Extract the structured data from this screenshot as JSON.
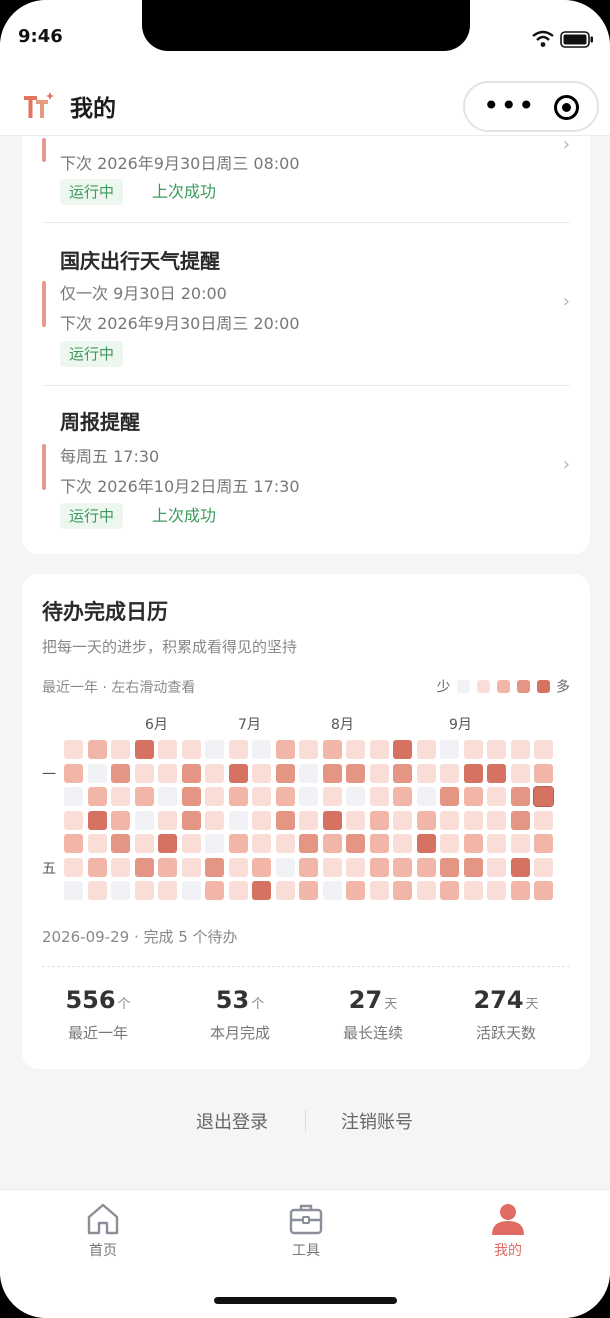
{
  "status": {
    "time": "9:46"
  },
  "header": {
    "title": "我的"
  },
  "reminders": [
    {
      "title": "",
      "line1": "",
      "next": "下次 2026年9月30日周三 08:00",
      "status": "运行中",
      "last": "上次成功"
    },
    {
      "title": "国庆出行天气提醒",
      "line1": "仅一次 9月30日 20:00",
      "next": "下次 2026年9月30日周三 20:00",
      "status": "运行中",
      "last": ""
    },
    {
      "title": "周报提醒",
      "line1": "每周五 17:30",
      "next": "下次 2026年10月2日周五 17:30",
      "status": "运行中",
      "last": "上次成功"
    }
  ],
  "calendar": {
    "title": "待办完成日历",
    "subtitle": "把每一天的进步，积累成看得见的坚持",
    "hint": "最近一年 · 左右滑动查看",
    "legend_less": "少",
    "legend_more": "多",
    "months": [
      "6月",
      "7月",
      "8月",
      "9月"
    ],
    "weekday_labels": [
      "一",
      "五"
    ],
    "selected": "2026-09-29 · 完成 5 个待办",
    "palette": [
      "#f1f2f5",
      "#f9ddd6",
      "#f1b6a7",
      "#e49584",
      "#d67261"
    ],
    "levels": [
      [
        1,
        2,
        1,
        4,
        1,
        1,
        0,
        1,
        0,
        2,
        1,
        2,
        1,
        1,
        4,
        1,
        0,
        1,
        1,
        1,
        1
      ],
      [
        2,
        0,
        3,
        1,
        1,
        3,
        1,
        4,
        1,
        3,
        0,
        3,
        3,
        1,
        3,
        1,
        1,
        4,
        4,
        1,
        2
      ],
      [
        0,
        2,
        1,
        2,
        0,
        3,
        1,
        2,
        1,
        2,
        0,
        1,
        0,
        1,
        2,
        0,
        3,
        2,
        1,
        3,
        4
      ],
      [
        1,
        4,
        2,
        0,
        1,
        3,
        1,
        0,
        1,
        3,
        1,
        4,
        1,
        2,
        1,
        2,
        1,
        1,
        1,
        3,
        1
      ],
      [
        2,
        1,
        3,
        1,
        4,
        1,
        0,
        2,
        1,
        1,
        3,
        2,
        3,
        2,
        1,
        4,
        1,
        2,
        1,
        1,
        2
      ],
      [
        1,
        2,
        1,
        3,
        2,
        1,
        3,
        1,
        2,
        0,
        2,
        1,
        1,
        2,
        2,
        2,
        3,
        3,
        1,
        4,
        1
      ],
      [
        0,
        1,
        0,
        1,
        1,
        0,
        2,
        1,
        4,
        1,
        2,
        0,
        2,
        1,
        2,
        1,
        2,
        1,
        1,
        2,
        2
      ]
    ]
  },
  "stats": [
    {
      "value": "556",
      "unit": "个",
      "label": "最近一年"
    },
    {
      "value": "53",
      "unit": "个",
      "label": "本月完成"
    },
    {
      "value": "27",
      "unit": "天",
      "label": "最长连续"
    },
    {
      "value": "274",
      "unit": "天",
      "label": "活跃天数"
    }
  ],
  "links": {
    "logout": "退出登录",
    "delete": "注销账号"
  },
  "tabs": [
    {
      "label": "首页",
      "icon": "home-icon"
    },
    {
      "label": "工具",
      "icon": "toolbox-icon"
    },
    {
      "label": "我的",
      "icon": "user-icon"
    }
  ],
  "colors": {
    "accent": "#e06b63",
    "success": "#3c9a5c",
    "accent_bar": "#e99890"
  }
}
